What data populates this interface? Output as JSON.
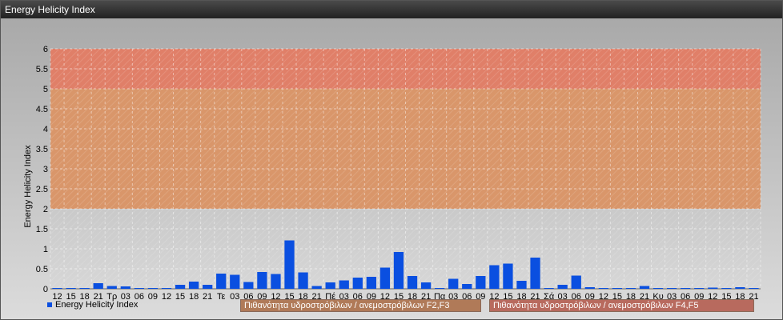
{
  "window": {
    "title": "Energy Helicity Index"
  },
  "chart_data": {
    "type": "bar",
    "title": "",
    "ylabel": "Energy Helicity Index",
    "xlabel": "",
    "ylim": [
      0,
      6
    ],
    "yticks": [
      0,
      0.5,
      1,
      1.5,
      2,
      2.5,
      3,
      3.5,
      4,
      4.5,
      5,
      5.5,
      6
    ],
    "yticks_text": [
      "0",
      "0.5",
      "1",
      "1.5",
      "2",
      "2.5",
      "3",
      "3.5",
      "4",
      "4.5",
      "5",
      "5.5",
      "6"
    ],
    "grid": true,
    "categories": [
      "12",
      "15",
      "18",
      "21",
      "Τρ",
      "03",
      "06",
      "09",
      "12",
      "15",
      "18",
      "21",
      "Τε",
      "03",
      "06",
      "09",
      "12",
      "15",
      "18",
      "21",
      "Πέ",
      "03",
      "06",
      "09",
      "12",
      "15",
      "18",
      "21",
      "Πα",
      "03",
      "06",
      "09",
      "12",
      "15",
      "18",
      "21",
      "Σά",
      "03",
      "06",
      "09",
      "12",
      "15",
      "18",
      "21",
      "Κυ",
      "03",
      "06",
      "09",
      "12",
      "15",
      "18",
      "21"
    ],
    "series": [
      {
        "name": "Energy Helicity Index",
        "color": "#0a4fe0",
        "values": [
          0.02,
          0.02,
          0.02,
          0.14,
          0.07,
          0.06,
          0.02,
          0.02,
          0.02,
          0.1,
          0.18,
          0.1,
          0.38,
          0.35,
          0.17,
          0.42,
          0.37,
          1.21,
          0.41,
          0.07,
          0.16,
          0.21,
          0.28,
          0.3,
          0.53,
          0.92,
          0.32,
          0.16,
          0.02,
          0.25,
          0.12,
          0.32,
          0.59,
          0.63,
          0.2,
          0.78,
          0.02,
          0.1,
          0.33,
          0.04,
          0.02,
          0.02,
          0.02,
          0.07,
          0.02,
          0.02,
          0.02,
          0.02,
          0.03,
          0.02,
          0.04,
          0.02
        ]
      }
    ],
    "bands": [
      {
        "from": 2,
        "to": 5,
        "color": "#d9966a"
      },
      {
        "from": 5,
        "to": 6,
        "color": "#e07f68"
      }
    ],
    "legend": {
      "placement": "bottom",
      "items": [
        {
          "label": "Πιθανότητα υδροστρόβιλων / ανεμοστρόβιλων F2,F3",
          "color": "#b07a58"
        },
        {
          "label": "Πιθανότητα υδροστρόβιλων / ανεμοστρόβιλων F4,F5",
          "color": "#b86a5e"
        }
      ]
    }
  }
}
